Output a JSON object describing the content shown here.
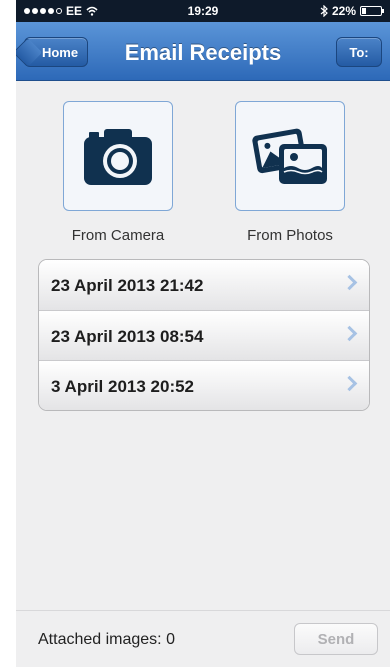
{
  "status_bar": {
    "carrier": "EE",
    "time": "19:29",
    "battery_text": "22%",
    "battery_level": 0.22
  },
  "nav": {
    "back_label": "Home",
    "title": "Email Receipts",
    "to_label": "To:"
  },
  "sources": [
    {
      "label": "From Camera",
      "icon": "camera-icon"
    },
    {
      "label": "From Photos",
      "icon": "photos-icon"
    }
  ],
  "receipts": [
    "23 April 2013 21:42",
    "23 April 2013 08:54",
    "3 April 2013 20:52"
  ],
  "footer": {
    "attached_text": "Attached images: 0",
    "send_label": "Send"
  },
  "colors": {
    "nav_blue": "#2d69b8",
    "icon_navy": "#10314f",
    "chevron": "#a7c2e4"
  }
}
